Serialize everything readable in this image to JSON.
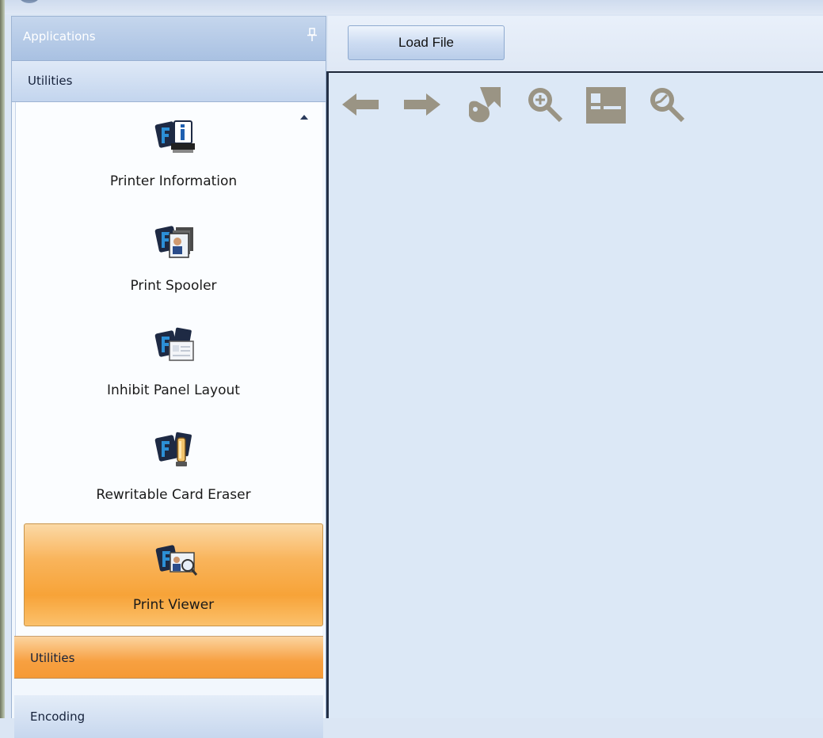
{
  "nav": {
    "title": "Applications",
    "group_header": "Utilities",
    "items": [
      {
        "label": "Printer Information",
        "icon": "printer-info-icon"
      },
      {
        "label": "Print Spooler",
        "icon": "print-spooler-icon"
      },
      {
        "label": "Inhibit Panel Layout",
        "icon": "inhibit-panel-icon"
      },
      {
        "label": "Rewritable Card Eraser",
        "icon": "card-eraser-icon"
      },
      {
        "label": "Print Viewer",
        "icon": "print-viewer-icon",
        "selected": true
      }
    ],
    "bottom_groups": [
      "Utilities",
      "Encoding"
    ]
  },
  "main": {
    "load_button": "Load File",
    "toolbar": [
      "back-arrow-icon",
      "forward-arrow-icon",
      "fit-page-icon",
      "zoom-in-icon",
      "page-view-icon",
      "zoom-out-icon"
    ]
  },
  "colors": {
    "selected_item": "#f7a338",
    "toolbar_icons_disabled": "#9a9484",
    "nav_header": "#b4c9e6"
  }
}
